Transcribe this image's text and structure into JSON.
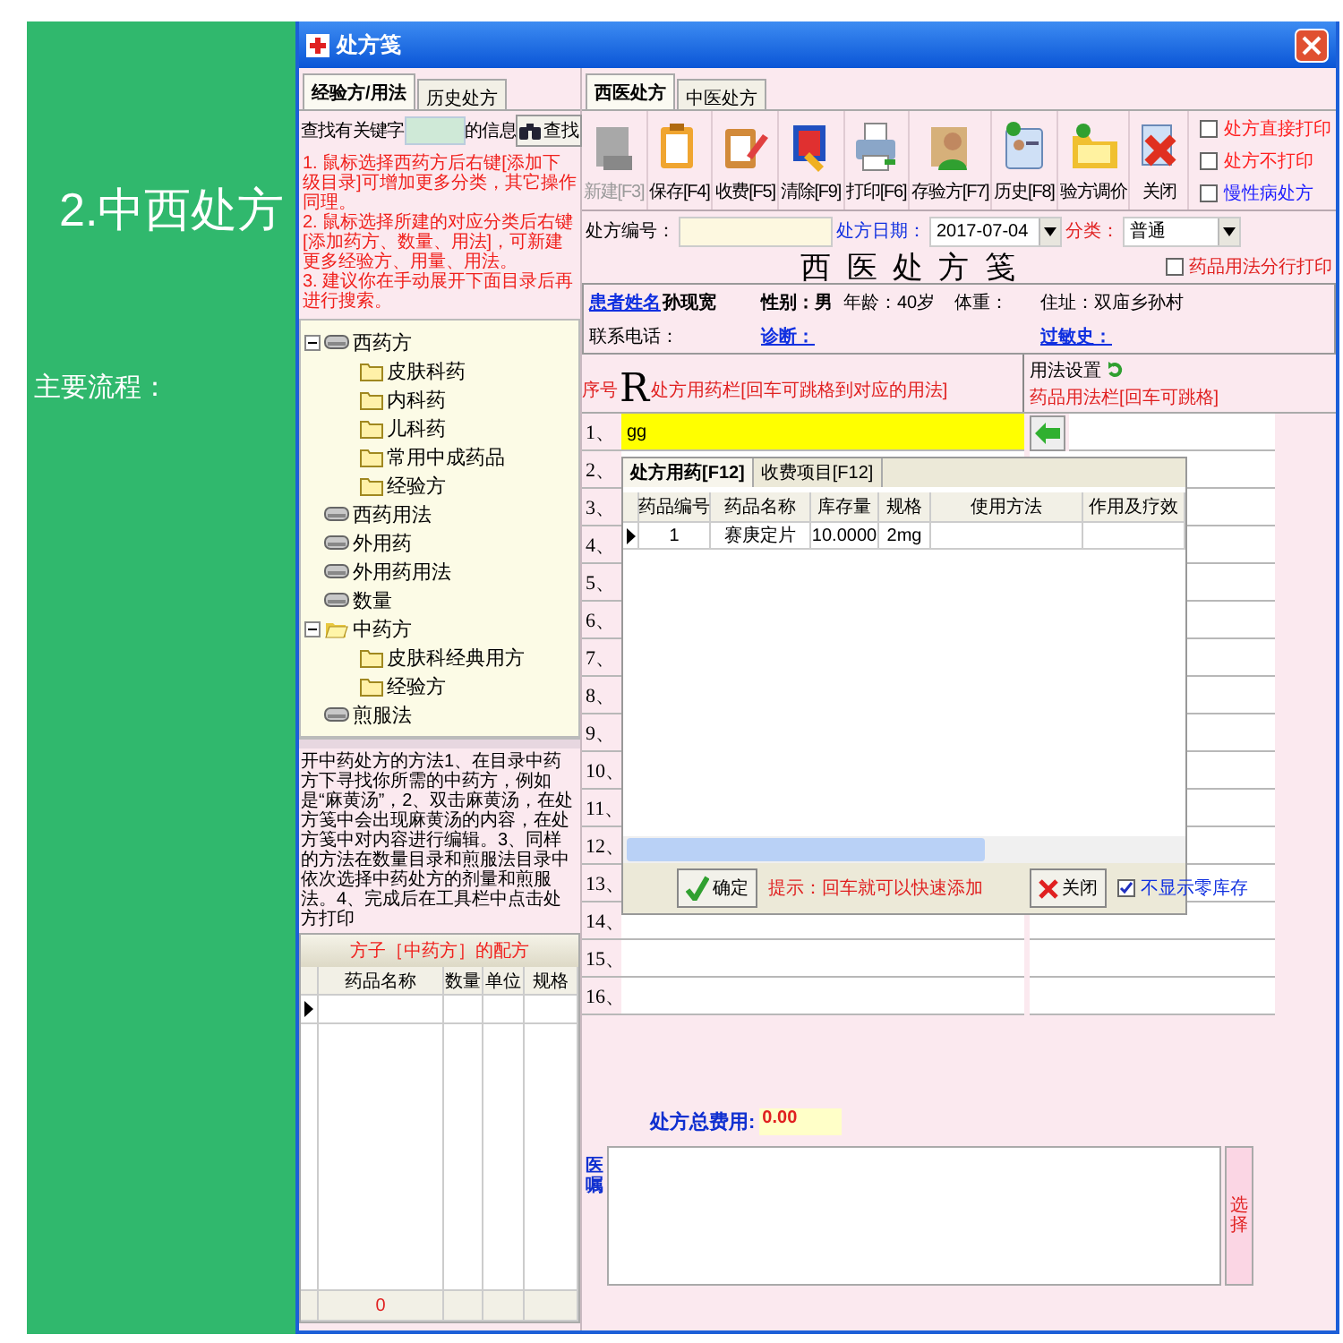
{
  "intro": {
    "title": "2.中西处方",
    "subtitle": "主要流程："
  },
  "window": {
    "title": "处方笺"
  },
  "left": {
    "tabs": [
      {
        "label": "经验方/用法",
        "selected": true
      },
      {
        "label": "历史处方",
        "selected": false
      }
    ],
    "search": {
      "label_before": "查找有关键字",
      "label_after": "的信息",
      "button": "查找"
    },
    "instructions": [
      "1. 鼠标选择西药方后右键[添加下级目录]可增加更多分类，其它操作同理。",
      "2. 鼠标选择所建的对应分类后右键[添加药方、数量、用法]，可新建更多经验方、用量、用法。",
      "3. 建议你在手动展开下面目录后再进行搜索。"
    ],
    "tree": [
      {
        "label": "西药方",
        "expanded": true,
        "selected": false,
        "children": [
          {
            "label": "皮肤科药"
          },
          {
            "label": "内科药"
          },
          {
            "label": "儿科药"
          },
          {
            "label": "常用中成药品"
          },
          {
            "label": "经验方"
          }
        ]
      },
      {
        "label": "西药用法",
        "selected": false
      },
      {
        "label": "外用药",
        "selected": false
      },
      {
        "label": "外用药用法",
        "selected": false
      },
      {
        "label": "数量",
        "selected": false
      },
      {
        "label": "中药方",
        "expanded": true,
        "selected": true,
        "children": [
          {
            "label": "皮肤科经典用方"
          },
          {
            "label": "经验方"
          }
        ]
      },
      {
        "label": "煎服法",
        "selected": false
      }
    ],
    "help_text": "开中药处方的方法1、在目录中药方下寻找你所需的中药方，例如是“麻黄汤”，2、双击麻黄汤，在处方笺中会出现麻黄汤的内容，在处方笺中对内容进行编辑。3、同样的方法在数量目录和煎服法目录中依次选择中药处方的剂量和煎服法。4、完成后在工具栏中点击处方打印",
    "formula_grid": {
      "title": "方子［中药方］的配方",
      "columns": [
        "药品名称",
        "数量",
        "单位",
        "规格"
      ],
      "footer": "0"
    }
  },
  "right": {
    "tabs": [
      {
        "label": "西医处方",
        "selected": true
      },
      {
        "label": "中医处方",
        "selected": false
      }
    ],
    "toolbar": [
      {
        "label": "新建[F3]",
        "disabled": true
      },
      {
        "label": "保存[F4]",
        "disabled": false
      },
      {
        "label": "收费[F5]",
        "disabled": false
      },
      {
        "label": "清除[F9]",
        "disabled": false
      },
      {
        "label": "打印[F6]",
        "disabled": false
      },
      {
        "label": "存验方[F7]",
        "disabled": false
      },
      {
        "label": "历史[F8]",
        "disabled": false
      },
      {
        "label": "验方调价",
        "disabled": false
      },
      {
        "label": "关闭",
        "disabled": false
      }
    ],
    "options": [
      {
        "label": "处方直接打印",
        "checked": false,
        "color": "#ff2020"
      },
      {
        "label": "处方不打印",
        "checked": false,
        "color": "#ff2020"
      },
      {
        "label": "慢性病处方",
        "checked": false,
        "color": "#2020ff"
      }
    ],
    "form": {
      "number_label": "处方编号：",
      "date_label": "处方日期：",
      "date": "2017-07-04",
      "category_label": "分类：",
      "category": "普通"
    },
    "heading": "西 医 处 方 笺",
    "split_print": {
      "label": "药品用法分行打印",
      "checked": false
    },
    "patient": {
      "name_label": "患者姓名",
      "name": "孙现宽",
      "gender": "性别：男",
      "age": "年龄：40岁",
      "weight": "体重：",
      "address": "住址：双庙乡孙村",
      "phone": "联系电话：",
      "diagnosis": "诊断：",
      "allergy": "过敏史："
    },
    "header": {
      "seq": "序号",
      "rx": "R",
      "drug_hint": "处方用药栏[回车可跳格到对应的用法]",
      "usage_title": "用法设置",
      "usage_hint": "药品用法栏[回车可跳格]"
    },
    "rows": [
      {
        "number": "1、",
        "value": "gg"
      },
      {
        "number": "2、"
      },
      {
        "number": "3、"
      },
      {
        "number": "4、"
      },
      {
        "number": "5、"
      },
      {
        "number": "6、"
      },
      {
        "number": "7、"
      },
      {
        "number": "8、"
      },
      {
        "number": "9、"
      },
      {
        "number": "10、"
      },
      {
        "number": "11、"
      },
      {
        "number": "12、"
      },
      {
        "number": "13、"
      },
      {
        "number": "14、"
      },
      {
        "number": "15、"
      },
      {
        "number": "16、"
      }
    ],
    "popup": {
      "tabs": [
        {
          "label": "处方用药[F12]",
          "selected": true
        },
        {
          "label": "收费项目[F12]",
          "selected": false
        }
      ],
      "columns": [
        "药品编号",
        "药品名称",
        "库存量",
        "规格",
        "使用方法",
        "作用及疗效"
      ],
      "rows": [
        {
          "cells": [
            "1",
            "赛庚定片",
            "10.0000",
            "2mg",
            "",
            ""
          ],
          "selected": true
        }
      ],
      "ok": "确定",
      "hint": "提示：回车就可以快速添加",
      "close": "关闭",
      "zero_stock": {
        "label": "不显示零库存",
        "checked": true
      }
    },
    "total": {
      "label": "处方总费用:",
      "value": "0.00"
    },
    "advice": {
      "label": "医嘱",
      "button": "选择"
    }
  }
}
